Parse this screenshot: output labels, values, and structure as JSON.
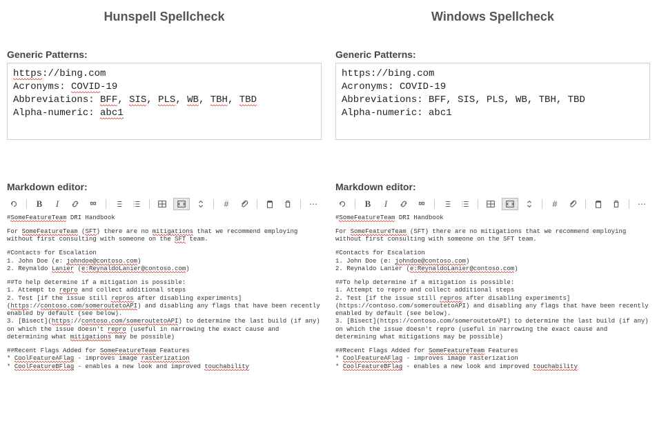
{
  "left": {
    "title": "Hunspell Spellcheck",
    "patterns_heading": "Generic Patterns:",
    "patterns": {
      "line1_a": "https",
      "line1_a_sq": true,
      "line1_b": "://bing.com",
      "line2_a": "Acronyms: ",
      "line2_b": "COVID",
      "line2_b_sq": true,
      "line2_c": "-19",
      "line3_a": "Abbreviations: ",
      "line3_items": [
        {
          "text": "BFF",
          "sq": true
        },
        {
          "text": "SIS",
          "sq": true
        },
        {
          "text": "PLS",
          "sq": true
        },
        {
          "text": "WB",
          "sq": true
        },
        {
          "text": "TBH",
          "sq": true
        },
        {
          "text": "TBD",
          "sq": true
        }
      ],
      "line4_a": "Alpha-numeric: ",
      "line4_b": "abc1",
      "line4_b_sq": true
    },
    "md_heading": "Markdown editor:",
    "md": {
      "l1_a": "#",
      "l1_b": "SomeFeatureTeam",
      "l1_b_sq": true,
      "l1_c": " DRI Handbook",
      "l2_a": "For ",
      "l2_b": "SomeFeatureTeam",
      "l2_b_sq": true,
      "l2_c": " (",
      "l2_d": "SFT",
      "l2_d_sq": true,
      "l2_e": ") there are no ",
      "l2_f": "mitigations",
      "l2_f_sq": true,
      "l2_g": " that we recommend employing without first consulting with someone on the ",
      "l2_h": "SFT",
      "l2_h_sq": true,
      "l2_i": " team.",
      "l3": "#Contacts for Escalation",
      "l4_a": "1. John Doe (e: ",
      "l4_b": "johndoe@contoso.com",
      "l4_b_sq": true,
      "l4_c": ")",
      "l5_a": "2. Reynaldo ",
      "l5_b": "Lanier",
      "l5_b_sq": true,
      "l5_c": " (",
      "l5_d": "e:ReynaldoLanier@contoso.com",
      "l5_d_sq": true,
      "l5_e": ")",
      "l6": "##To help determine if a mitigation is possible:",
      "l7_a": "1. Attempt to ",
      "l7_b": "repro",
      "l7_b_sq": true,
      "l7_c": " and collect additional steps",
      "l8_a": "2. Test [if the issue still ",
      "l8_b": "repros",
      "l8_b_sq": true,
      "l8_c": " after disabling experiments](",
      "l8_d": "https",
      "l8_d_sq": true,
      "l8_e": "://",
      "l8_f": "contoso.com/someroutetoAPI",
      "l8_f_sq": true,
      "l8_g": ") and disabling any flags that have been recently enabled by default (see below).",
      "l9_a": "3. [Bisect](",
      "l9_b": "https",
      "l9_b_sq": true,
      "l9_c": "://",
      "l9_d": "contoso.com/someroutetoAPI",
      "l9_d_sq": true,
      "l9_e": ") to determine the last build (if any) on which the issue doesn't ",
      "l9_f": "repro",
      "l9_f_sq": true,
      "l9_g": " (useful in narrowing the exact cause and determining what ",
      "l9_h": "mitigations",
      "l9_h_sq": true,
      "l9_i": " may be possible)",
      "l10_a": "##Recent Flags Added for ",
      "l10_b": "SomeFeatureTeam",
      "l10_b_sq": true,
      "l10_c": " Features",
      "l11_a": "* ",
      "l11_b": "CoolFeatureAFlag",
      "l11_b_sq": true,
      "l11_c": " - improves image ",
      "l11_d": "rasterization",
      "l11_d_sq": true,
      "l12_a": "* ",
      "l12_b": "CoolFeatureBFlag",
      "l12_b_sq": true,
      "l12_c": " - enables a new look and improved ",
      "l12_d": "touchability",
      "l12_d_sq": true
    }
  },
  "right": {
    "title": "Windows Spellcheck",
    "patterns_heading": "Generic Patterns:",
    "patterns": {
      "line1": "https://bing.com",
      "line2": "Acronyms: COVID-19",
      "line3": "Abbreviations: BFF, SIS, PLS, WB, TBH, TBD",
      "line4": "Alpha-numeric: abc1"
    },
    "md_heading": "Markdown editor:",
    "md": {
      "l1_a": "#",
      "l1_b": "SomeFeatureTeam",
      "l1_b_sq": true,
      "l1_c": " DRI Handbook",
      "l2_a": "For ",
      "l2_b": "SomeFeatureTeam",
      "l2_b_sq": true,
      "l2_c": " (SFT) there are no mitigations that we recommend employing without first consulting with someone on the SFT team.",
      "l3": "#Contacts for Escalation",
      "l4_a": "1. John Doe (e: ",
      "l4_b": "johndoe@contoso.com",
      "l4_b_sq": true,
      "l4_c": ")",
      "l5_a": "2. Reynaldo Lanier (",
      "l5_b": "e:ReynaldoLanier@contoso.com",
      "l5_b_sq": true,
      "l5_c": ")",
      "l6": "##To help determine if a mitigation is possible:",
      "l7": "1. Attempt to repro and collect additional steps",
      "l8_a": "2. Test [if the issue still ",
      "l8_b": "repros",
      "l8_b_sq": true,
      "l8_c": " after disabling experiments](https://contoso.com/someroutetoAPI) and disabling any flags that have been recently enabled by default (see below).",
      "l9": "3. [Bisect](https://contoso.com/someroutetoAPI) to determine the last build (if any) on which the issue doesn't repro (useful in narrowing the exact cause and determining what mitigations may be possible)",
      "l10_a": "##Recent Flags Added for ",
      "l10_b": "SomeFeatureTeam",
      "l10_b_sq": true,
      "l10_c": " Features",
      "l11_a": "* ",
      "l11_b": "CoolFeatureAFlag",
      "l11_b_sq": true,
      "l11_c": " - improves image rasterization",
      "l12_a": "* ",
      "l12_b": "CoolFeatureBFlag",
      "l12_b_sq": true,
      "l12_c": " - enables a new look and improved ",
      "l12_d": "touchability",
      "l12_d_sq": true
    }
  },
  "toolbar_icons": {
    "undo": "undo-icon",
    "bold": "B",
    "italic": "I",
    "link": "link-icon",
    "quote": "quote-icon",
    "ul": "list-ul-icon",
    "ol": "list-ol-icon",
    "table": "table-icon",
    "code": "code-icon",
    "updown": "chevron-updown-icon",
    "hash": "#",
    "attach": "paperclip-icon",
    "clipboard": "clipboard-icon",
    "trash": "trash-icon",
    "dots": "..."
  }
}
